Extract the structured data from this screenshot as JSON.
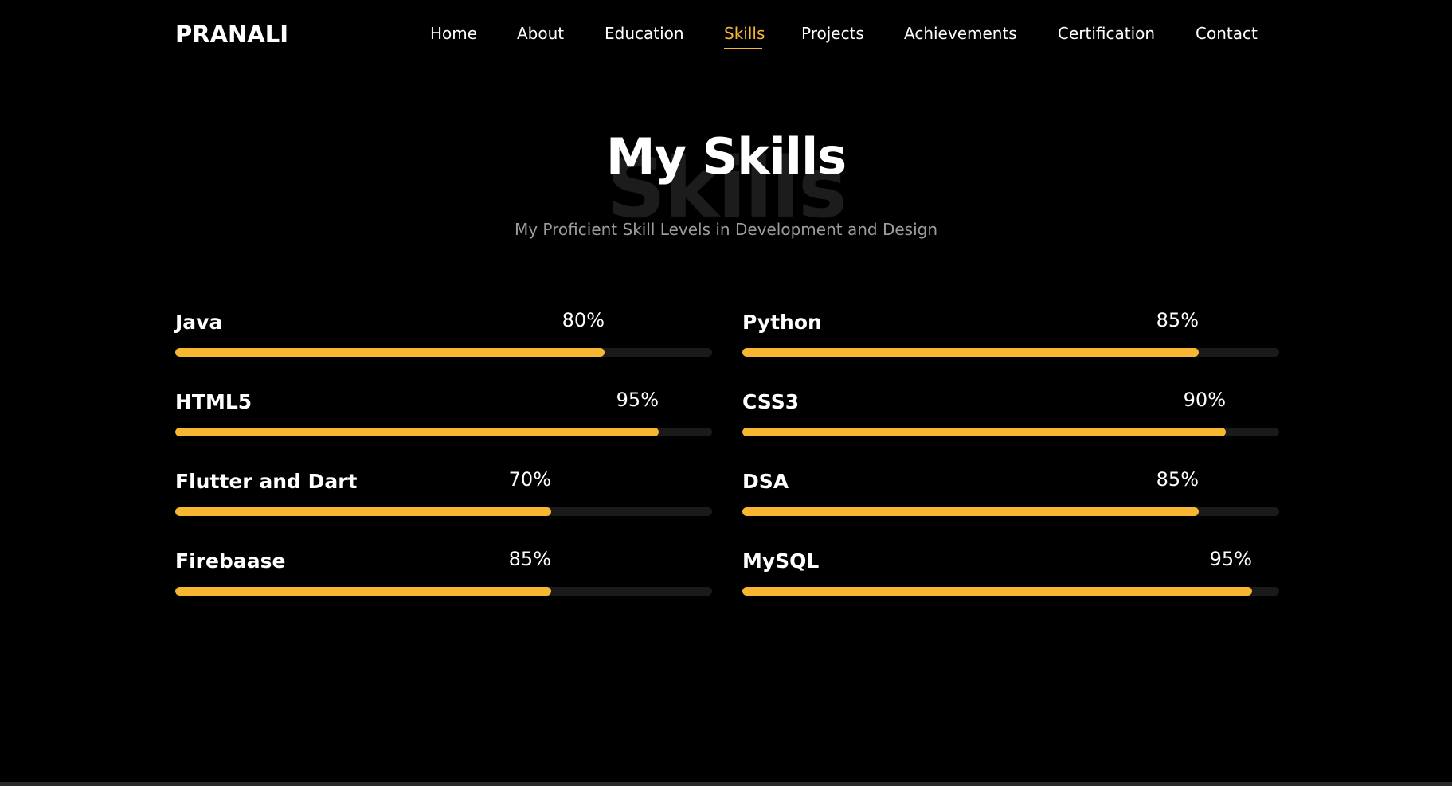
{
  "header": {
    "logo": "PRANALI",
    "nav": [
      {
        "label": "Home",
        "active": false
      },
      {
        "label": "About",
        "active": false
      },
      {
        "label": "Education",
        "active": false
      },
      {
        "label": "Skills",
        "active": true
      },
      {
        "label": "Projects",
        "active": false
      },
      {
        "label": "Achievements",
        "active": false
      },
      {
        "label": "Certification",
        "active": false
      },
      {
        "label": "Contact",
        "active": false
      }
    ]
  },
  "section": {
    "background_word": "Skills",
    "title": "My Skills",
    "subtitle": "My Proficient Skill Levels in Development and Design"
  },
  "skills": {
    "left": [
      {
        "name": "Java",
        "percent_label": "80%",
        "level": 0.8
      },
      {
        "name": "HTML5",
        "percent_label": "95%",
        "level": 0.9
      },
      {
        "name": "Flutter and Dart",
        "percent_label": "70%",
        "level": 0.7
      },
      {
        "name": "Firebaase",
        "percent_label": "85%",
        "level": 0.7
      }
    ],
    "right": [
      {
        "name": "Python",
        "percent_label": "85%",
        "level": 0.85
      },
      {
        "name": "CSS3",
        "percent_label": "90%",
        "level": 0.9
      },
      {
        "name": "DSA",
        "percent_label": "85%",
        "level": 0.85
      },
      {
        "name": "MySQL",
        "percent_label": "95%",
        "level": 0.95
      }
    ]
  },
  "colors": {
    "accent": "#f7b733",
    "background": "#000000",
    "track": "#1a1a1a",
    "text": "#ffffff",
    "muted": "#9c9c9c"
  }
}
